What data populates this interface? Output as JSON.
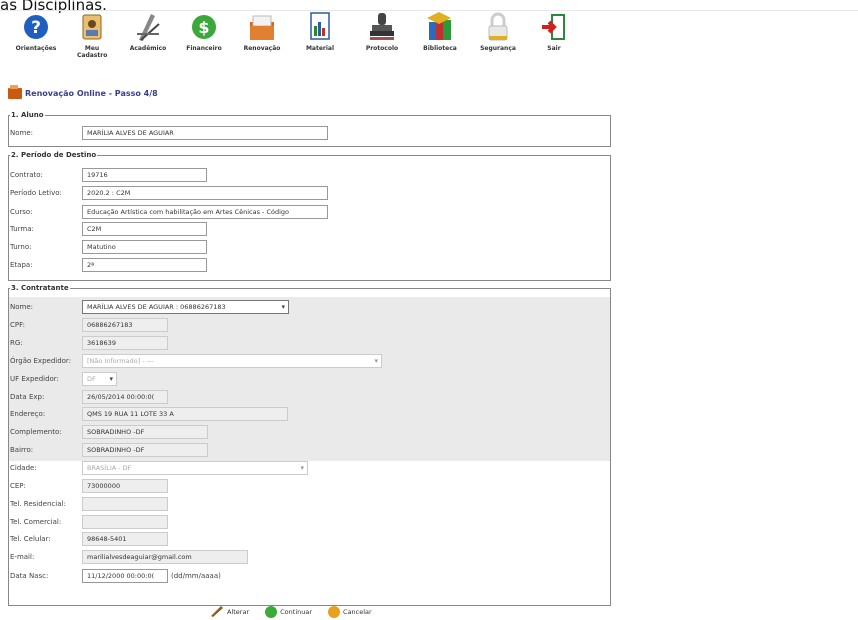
{
  "top_cut_text": "as Disciplinas.",
  "toolbar": {
    "items": [
      {
        "label": "Orientações"
      },
      {
        "label": "Meu Cadastro"
      },
      {
        "label": "Acadêmico"
      },
      {
        "label": "Financeiro"
      },
      {
        "label": "Renovação"
      },
      {
        "label": "Material"
      },
      {
        "label": "Protocolo"
      },
      {
        "label": "Biblioteca"
      },
      {
        "label": "Segurança"
      },
      {
        "label": "Sair"
      }
    ]
  },
  "page_title": "Renovação Online - Passo 4/8",
  "aluno": {
    "legend": "1. Aluno",
    "nome_label": "Nome:",
    "nome_value": "MARÍLIA ALVES DE AGUIAR"
  },
  "periodo": {
    "legend": "2. Período de Destino",
    "contrato_label": "Contrato:",
    "contrato_value": "19716",
    "periodo_label": "Período Letivo:",
    "periodo_value": "2020.2 : C2M",
    "curso_label": "Curso:",
    "curso_value": "Educação Artística com habilitação em Artes Cênicas - Código",
    "turma_label": "Turma:",
    "turma_value": "C2M",
    "turno_label": "Turno:",
    "turno_value": "Matutino",
    "etapa_label": "Etapa:",
    "etapa_value": "2ª"
  },
  "contratante": {
    "legend": "3. Contratante",
    "nome_label": "Nome:",
    "nome_value": "MARÍLIA ALVES DE AGUIAR : 06886267183",
    "cpf_label": "CPF:",
    "cpf_value": "06886267183",
    "rg_label": "RG:",
    "rg_value": "3618639",
    "orgao_label": "Órgão Expedidor:",
    "orgao_value": "[Não Informado] - ---",
    "uf_label": "UF Expedidor:",
    "uf_value": "DF",
    "data_exp_label": "Data Exp:",
    "data_exp_value": "26/05/2014 00:00:0(",
    "endereco_label": "Endereço:",
    "endereco_value": "QMS 19 RUA 11 LOTE 33 A",
    "complemento_label": "Complemento:",
    "complemento_value": "SOBRADINHO -DF",
    "bairro_label": "Bairro:",
    "bairro_value": "SOBRADINHO -DF",
    "cidade_label": "Cidade:",
    "cidade_value": "BRASÍLIA - DF",
    "cep_label": "CEP:",
    "cep_value": "73000000",
    "tel_res_label": "Tel. Residencial:",
    "tel_res_value": "",
    "tel_com_label": "Tel. Comercial:",
    "tel_com_value": "",
    "tel_cel_label": "Tel. Celular:",
    "tel_cel_value": "98648-5401",
    "email_label": "E-mail:",
    "email_value": "marilialvesdeaguiar@gmail.com",
    "data_nasc_label": "Data Nasc:",
    "data_nasc_value": "11/12/2000 00:00:0(",
    "data_nasc_hint": "(dd/mm/aaaa)"
  },
  "buttons": {
    "alterar": "Alterar",
    "continuar": "Continuar",
    "cancelar": "Cancelar"
  },
  "colors": {
    "title": "#3a3f8f",
    "border": "#888888"
  }
}
